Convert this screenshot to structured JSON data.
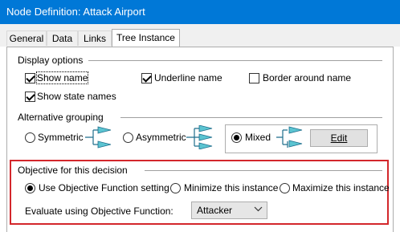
{
  "window": {
    "title": "Node Definition: Attack Airport"
  },
  "tabs": [
    {
      "label": "General"
    },
    {
      "label": "Data"
    },
    {
      "label": "Links"
    },
    {
      "label": "Tree Instance",
      "active": true
    }
  ],
  "display_options": {
    "title": "Display options",
    "show_name": {
      "label": "Show name",
      "checked": true
    },
    "underline_name": {
      "label": "Underline name",
      "checked": true
    },
    "border_around_name": {
      "label": "Border around name",
      "checked": false
    },
    "show_state_names": {
      "label": "Show state names",
      "checked": true
    }
  },
  "alternative_grouping": {
    "title": "Alternative grouping",
    "options": [
      {
        "label": "Symmetric",
        "selected": false
      },
      {
        "label": "Asymmetric",
        "selected": false
      },
      {
        "label": "Mixed",
        "selected": true
      }
    ],
    "edit_button": "Edit"
  },
  "objective": {
    "title": "Objective for this decision",
    "options": [
      {
        "label": "Use Objective Function setting",
        "selected": true
      },
      {
        "label": "Minimize this instance",
        "selected": false
      },
      {
        "label": "Maximize this instance",
        "selected": false
      }
    ],
    "evaluate_label": "Evaluate using Objective Function:",
    "evaluate_value": "Attacker"
  },
  "colors": {
    "titlebar": "#0078d7",
    "highlight_frame": "#d3272b",
    "tree_fill": "#5bc4d1",
    "tree_stroke": "#1e6e8c"
  },
  "icons": [
    "tree-branch-icon",
    "chevron-down-icon"
  ]
}
